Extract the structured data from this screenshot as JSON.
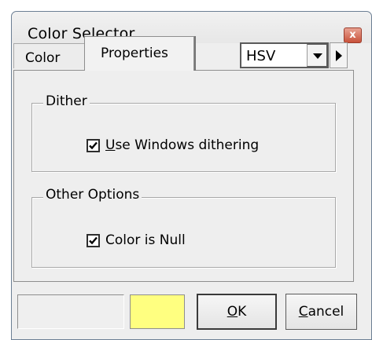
{
  "window": {
    "title": "Color Selector",
    "close_glyph": "x"
  },
  "tabs": [
    {
      "label": "Color",
      "active": false
    },
    {
      "label": "Properties",
      "active": true
    }
  ],
  "model_select": {
    "value": "HSV"
  },
  "groups": {
    "dither": {
      "legend": "Dither",
      "checkbox": {
        "mnemonic": "U",
        "label_rest": "se Windows dithering",
        "checked": true
      }
    },
    "other_options": {
      "legend": "Other Options",
      "checkbox": {
        "label": "Color is Null",
        "checked": true
      }
    }
  },
  "swatches": {
    "current_color": "#ffff80"
  },
  "buttons": {
    "ok_mnemonic": "O",
    "ok_rest": "K",
    "cancel_mnemonic": "C",
    "cancel_rest": "ancel"
  },
  "colors": {
    "dialog_bg": "#eeeeee",
    "close_button": "#c8513a",
    "swatch_yellow": "#ffff80"
  },
  "icons": [
    "close-icon",
    "chevron-down-icon",
    "chevron-right-icon",
    "checkmark-icon"
  ]
}
